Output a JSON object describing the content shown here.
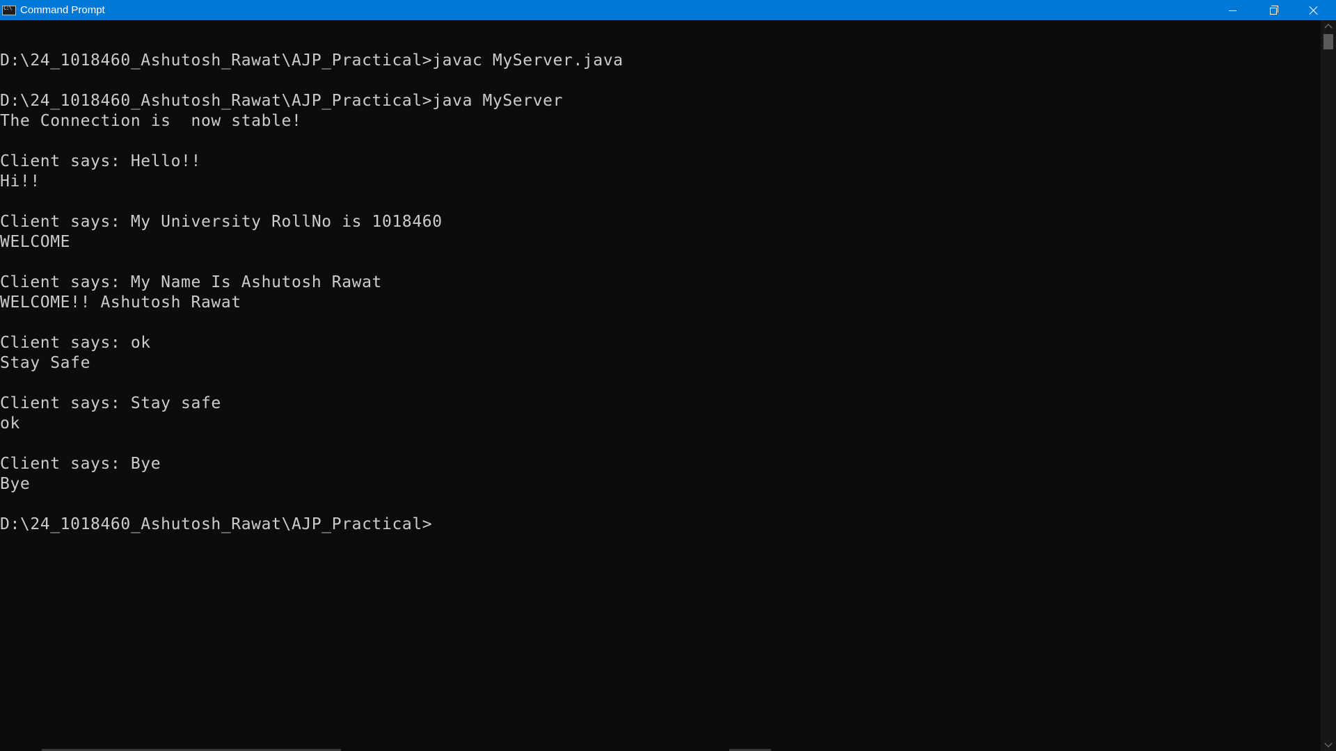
{
  "window": {
    "title": "Command Prompt"
  },
  "console": {
    "lines": [
      "D:\\24_1018460_Ashutosh_Rawat\\AJP_Practical>javac MyServer.java",
      "",
      "D:\\24_1018460_Ashutosh_Rawat\\AJP_Practical>java MyServer",
      "The Connection is  now stable!",
      "",
      "Client says: Hello!!",
      "Hi!!",
      "",
      "Client says: My University RollNo is 1018460",
      "WELCOME",
      "",
      "Client says: My Name Is Ashutosh Rawat",
      "WELCOME!! Ashutosh Rawat",
      "",
      "Client says: ok",
      "Stay Safe",
      "",
      "Client says: Stay safe",
      "ok",
      "",
      "Client says: Bye",
      "Bye",
      "",
      "D:\\24_1018460_Ashutosh_Rawat\\AJP_Practical>"
    ]
  },
  "colors": {
    "titlebar": "#0078d7",
    "console_bg": "#0c0c0c",
    "console_text": "#cccccc"
  }
}
